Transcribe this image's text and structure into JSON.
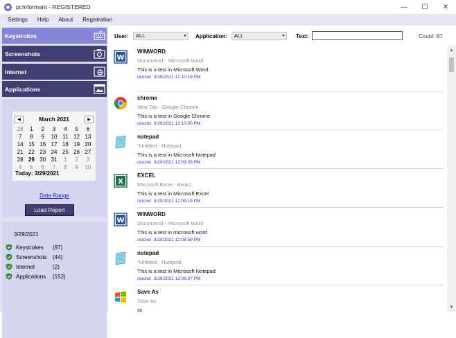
{
  "window": {
    "title": "pcInformant - REGISTERED"
  },
  "menu": [
    "Settings",
    "Help",
    "About",
    "Registration"
  ],
  "nav": [
    {
      "label": "Keystrokes",
      "active": true,
      "icon": "keyboard-icon"
    },
    {
      "label": "Screenshots",
      "active": false,
      "icon": "camera-icon"
    },
    {
      "label": "Internet",
      "active": false,
      "icon": "internet-icon"
    },
    {
      "label": "Applications",
      "active": false,
      "icon": "applications-icon"
    }
  ],
  "calendar": {
    "month_label": "March 2021",
    "weeks": [
      [
        "28",
        "1",
        "2",
        "3",
        "4",
        "5",
        "6"
      ],
      [
        "7",
        "8",
        "9",
        "10",
        "11",
        "12",
        "13"
      ],
      [
        "14",
        "15",
        "16",
        "17",
        "18",
        "19",
        "20"
      ],
      [
        "21",
        "22",
        "23",
        "24",
        "25",
        "26",
        "27"
      ],
      [
        "28",
        "29",
        "30",
        "31",
        "1",
        "2",
        "3"
      ],
      [
        "4",
        "5",
        "6",
        "7",
        "8",
        "9",
        "10"
      ]
    ],
    "today_label": "Today: 3/29/2021"
  },
  "date_range_link": "Date Range",
  "load_report_button": "Load Report",
  "summary": {
    "date": "3/29/2021",
    "rows": [
      {
        "label": "Keystrokes",
        "count": "(97)"
      },
      {
        "label": "Screenshots",
        "count": "(44)"
      },
      {
        "label": "Internet",
        "count": "(2)"
      },
      {
        "label": "Applications",
        "count": "(152)"
      }
    ]
  },
  "filters": {
    "user_label": "User:",
    "user_value": "ALL",
    "application_label": "Application:",
    "application_value": "ALL",
    "text_label": "Text:",
    "text_value": "",
    "count_label": "Count: 97"
  },
  "entries": [
    {
      "icon": "word-icon",
      "app": "WINWORD",
      "window": "Document1 - Microsoft Word",
      "text": "This is a test in Microsoft Word",
      "user": "ckoziel",
      "timestamp": "3/29/2021 12:10:18 PM"
    },
    {
      "icon": "chrome-icon",
      "app": "chrome",
      "window": "New Tab - Google Chrome",
      "text": "This is a test in Google Chrome",
      "user": "ckoziel",
      "timestamp": "3/29/2021 12:10:00 PM"
    },
    {
      "icon": "notepad-icon",
      "app": "notepad",
      "window": "*Untitled - Notepad",
      "text": "This is a test in Microsoft Notepad",
      "user": "ckoziel",
      "timestamp": "3/29/2021 12:09:39 PM"
    },
    {
      "icon": "excel-icon",
      "app": "EXCEL",
      "window": "Microsoft Excel - Book1",
      "text": "This is a test in Microsoft Excel",
      "user": "ckoziel",
      "timestamp": "3/29/2021 12:09:15 PM"
    },
    {
      "icon": "word-icon",
      "app": "WINWORD",
      "window": "Document1 - Microsoft Word",
      "text": "This is a test in microsoft word",
      "user": "ckoziel",
      "timestamp": "3/29/2021 12:08:59 PM"
    },
    {
      "icon": "notepad-icon",
      "app": "notepad",
      "window": "*Untitled - Notepad",
      "text": "This is a test in Microsoft Notepad",
      "user": "ckoziel",
      "timestamp": "3/29/2021 12:08:37 PM"
    },
    {
      "icon": "windows-icon",
      "app": "Save As",
      "window": "Save As",
      "text": "sc",
      "user": "",
      "timestamp": ""
    }
  ]
}
